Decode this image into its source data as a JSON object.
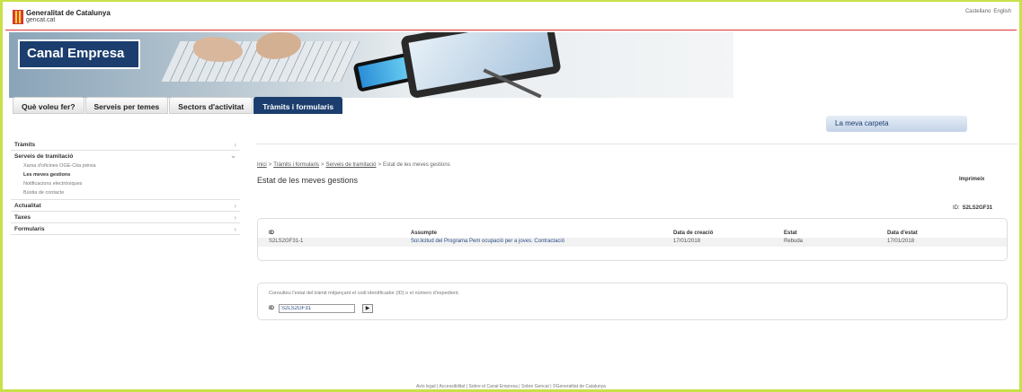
{
  "header": {
    "logo_line1": "Generalitat de Catalunya",
    "logo_line2": "gencat.cat",
    "languages": [
      "Castellano",
      "English"
    ]
  },
  "banner": {
    "title": "Canal Empresa"
  },
  "nav": {
    "tabs": [
      {
        "label": "Què voleu fer?",
        "active": false
      },
      {
        "label": "Serveis per temes",
        "active": false
      },
      {
        "label": "Sectors d'activitat",
        "active": false
      },
      {
        "label": "Tràmits i formularis",
        "active": true
      }
    ],
    "carpeta_label": "La meva carpeta"
  },
  "sidebar": {
    "items": [
      {
        "label": "Tràmits"
      },
      {
        "label": "Serveis de tramitació",
        "expanded": true,
        "subitems": [
          {
            "label": "Xarxa d'oficines OGE-Cita prèvia"
          },
          {
            "label": "Les meves gestions",
            "current": true
          },
          {
            "label": "Notificacions electròniques"
          },
          {
            "label": "Bústia de contacte"
          }
        ]
      },
      {
        "label": "Actualitat"
      },
      {
        "label": "Taxes"
      },
      {
        "label": "Formularis"
      }
    ]
  },
  "main": {
    "breadcrumb": [
      "Inici",
      "Tràmits i formularis",
      "Serveis de tramitació",
      "Estat de les meves gestions"
    ],
    "breadcrumb_sep": ">",
    "title": "Estat de les meves gestions",
    "print_label": "Imprimeix",
    "id_label": "ID:",
    "id_value": "S2LS2GF31",
    "table": {
      "headers": [
        "ID",
        "Assumpte",
        "Data de creació",
        "Estat",
        "Data d'estat"
      ],
      "rows": [
        [
          "S2LS2GF31-1",
          "Sol.licitud del Programa Pem ocupació per a joves. Contractació",
          "17/01/2018",
          "Rebuda",
          "17/01/2018"
        ]
      ]
    },
    "query": {
      "help_text": "Consulteu l'estat del tràmit mitjançant el codi identificador (ID) o el número d'expedient.",
      "id_label": "ID",
      "input_value": "S2LS2GF31",
      "button_glyph": "▶"
    }
  },
  "footer": {
    "links": [
      "Avís legal",
      "Accessibilitat",
      "Sobre el Canal Empresa",
      "Sobre Gencat",
      "©Generalitat de Catalunya"
    ],
    "separator": " | "
  }
}
